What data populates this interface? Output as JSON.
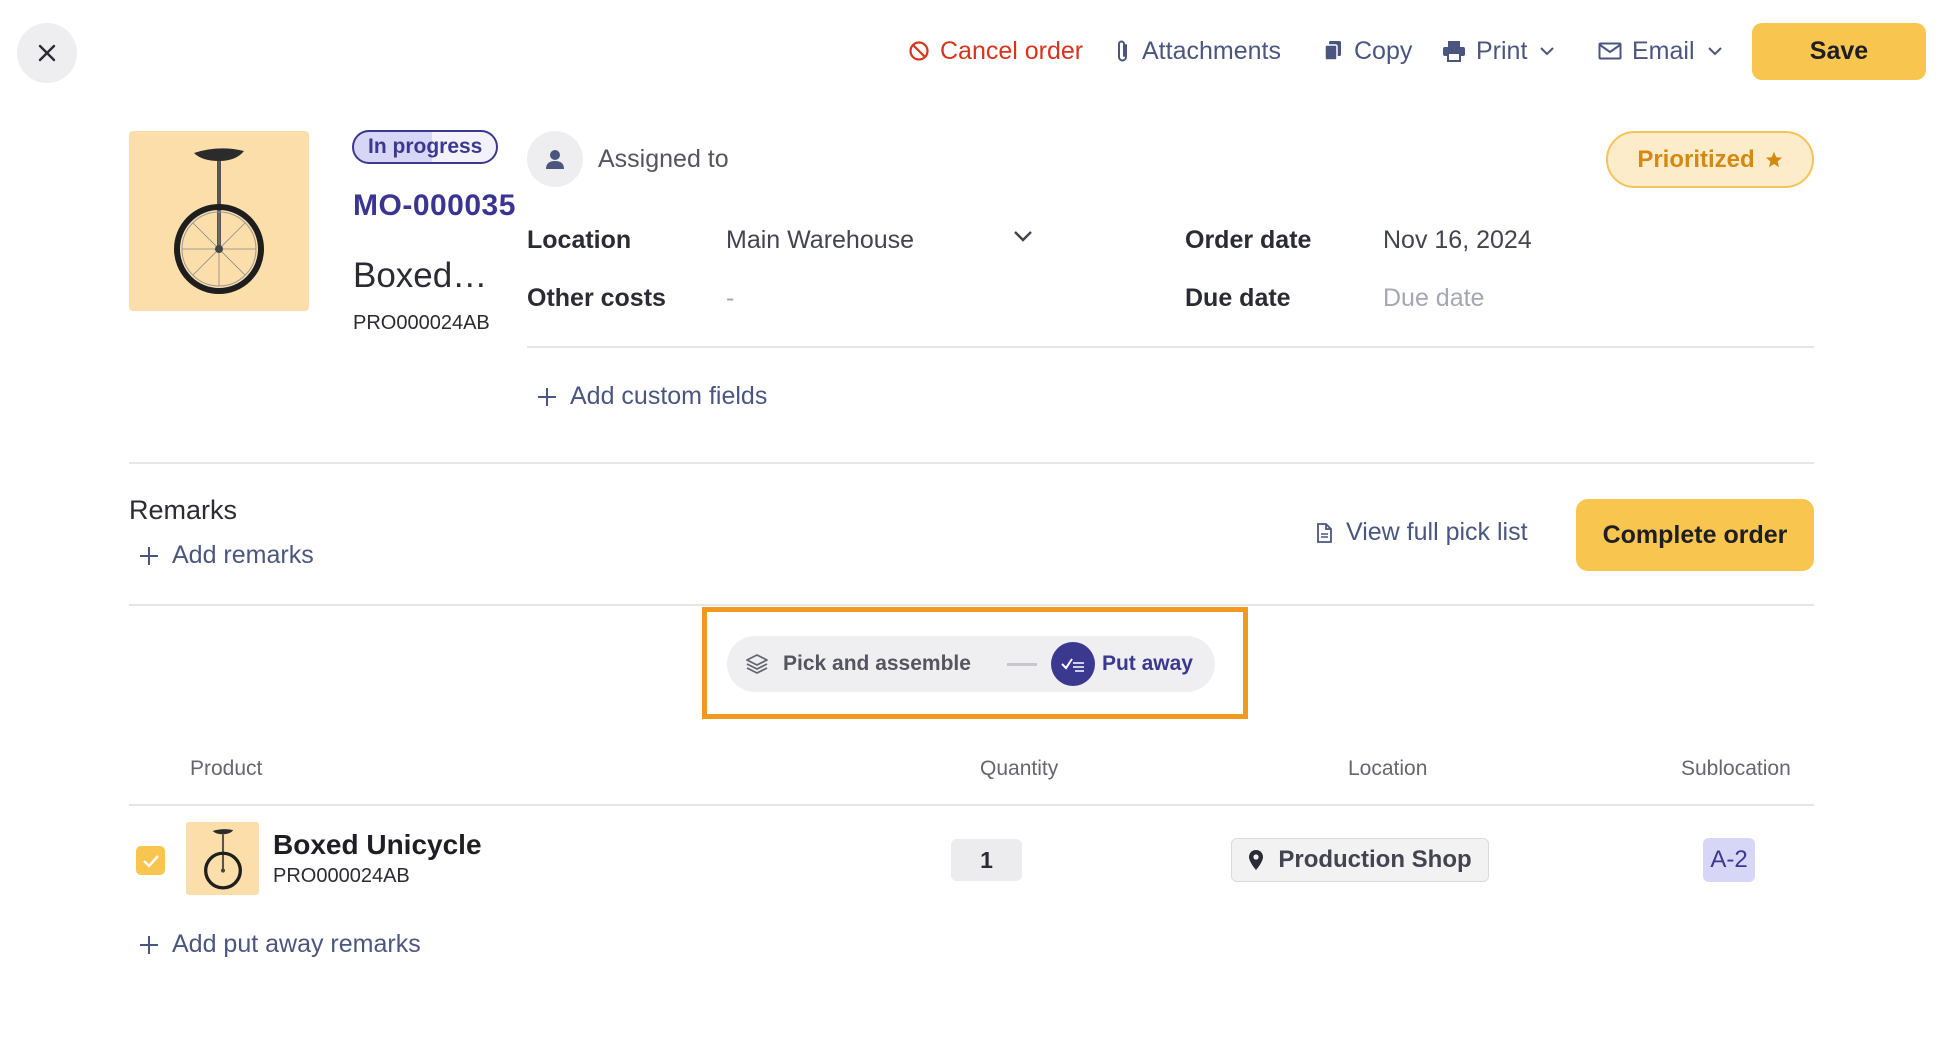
{
  "toolbar": {
    "cancel_label": "Cancel order",
    "attachments_label": "Attachments",
    "copy_label": "Copy",
    "print_label": "Print",
    "email_label": "Email",
    "save_label": "Save"
  },
  "order": {
    "status": "In progress",
    "id": "MO-000035",
    "product_name": "Boxed…",
    "product_code": "PRO000024AB",
    "assigned_label": "Assigned to",
    "priority_label": "Prioritized",
    "fields": {
      "location_label": "Location",
      "location_value": "Main Warehouse",
      "other_costs_label": "Other costs",
      "other_costs_value": "-",
      "order_date_label": "Order date",
      "order_date_value": "Nov 16, 2024",
      "due_date_label": "Due date",
      "due_date_placeholder": "Due date"
    },
    "add_custom_fields": "Add custom fields"
  },
  "remarks": {
    "title": "Remarks",
    "add_label": "Add remarks",
    "pick_list_label": "View full pick list",
    "complete_label": "Complete order"
  },
  "stepper": {
    "step1": "Pick and assemble",
    "step2": "Put away",
    "active_step": 2
  },
  "table": {
    "headers": {
      "product": "Product",
      "quantity": "Quantity",
      "location": "Location",
      "sublocation": "Sublocation"
    },
    "rows": [
      {
        "checked": true,
        "name": "Boxed Unicycle",
        "code": "PRO000024AB",
        "quantity": "1",
        "location": "Production Shop",
        "sublocation": "A-2"
      }
    ],
    "add_putaway_remarks": "Add put away remarks"
  },
  "colors": {
    "accent_yellow": "#f8c64f",
    "brand_purple": "#3b3890",
    "danger_red": "#d6341c",
    "highlight_orange": "#ef9a1f",
    "link_slate": "#4b5680"
  }
}
